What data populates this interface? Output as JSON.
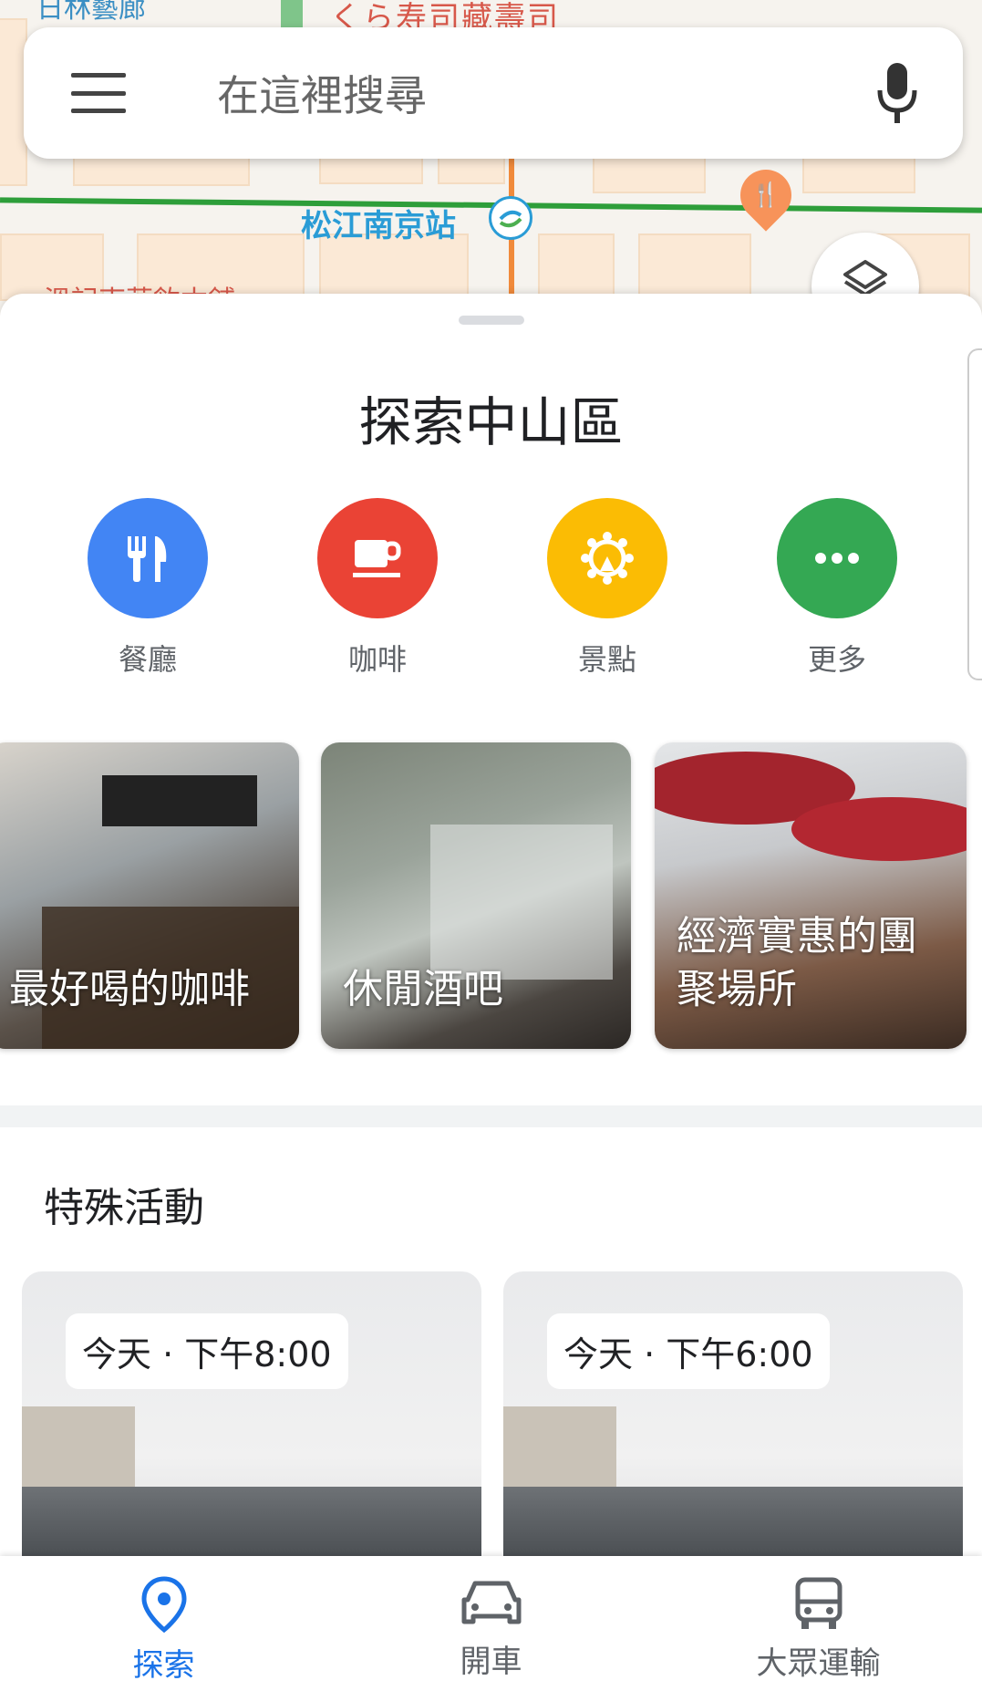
{
  "map": {
    "label_top_left": "日林藝廊",
    "label_top_center": "くら寿司藏壽司",
    "station_name": "松江南京站",
    "label_bottom_left": "溫記東華飲本舖"
  },
  "search": {
    "placeholder": "在這裡搜尋"
  },
  "sheet": {
    "title": "探索中山區",
    "categories": [
      {
        "label": "餐廳",
        "color": "#4285f4",
        "icon": "restaurant-icon"
      },
      {
        "label": "咖啡",
        "color": "#ea4335",
        "icon": "coffee-icon"
      },
      {
        "label": "景點",
        "color": "#fbbc04",
        "icon": "attractions-icon"
      },
      {
        "label": "更多",
        "color": "#34a853",
        "icon": "more-icon"
      }
    ],
    "cards": [
      {
        "caption": "最好喝的咖啡"
      },
      {
        "caption": "休閒酒吧"
      },
      {
        "caption": "經濟實惠的團聚場所"
      }
    ],
    "events_title": "特殊活動",
    "events": [
      {
        "time": "今天 · 下午8:00"
      },
      {
        "time": "今天 · 下午6:00"
      }
    ]
  },
  "nav": {
    "items": [
      {
        "label": "探索",
        "icon": "explore-pin-icon",
        "active": true
      },
      {
        "label": "開車",
        "icon": "car-icon",
        "active": false
      },
      {
        "label": "大眾運輸",
        "icon": "bus-icon",
        "active": false
      }
    ]
  },
  "colors": {
    "accent": "#1a73e8"
  }
}
